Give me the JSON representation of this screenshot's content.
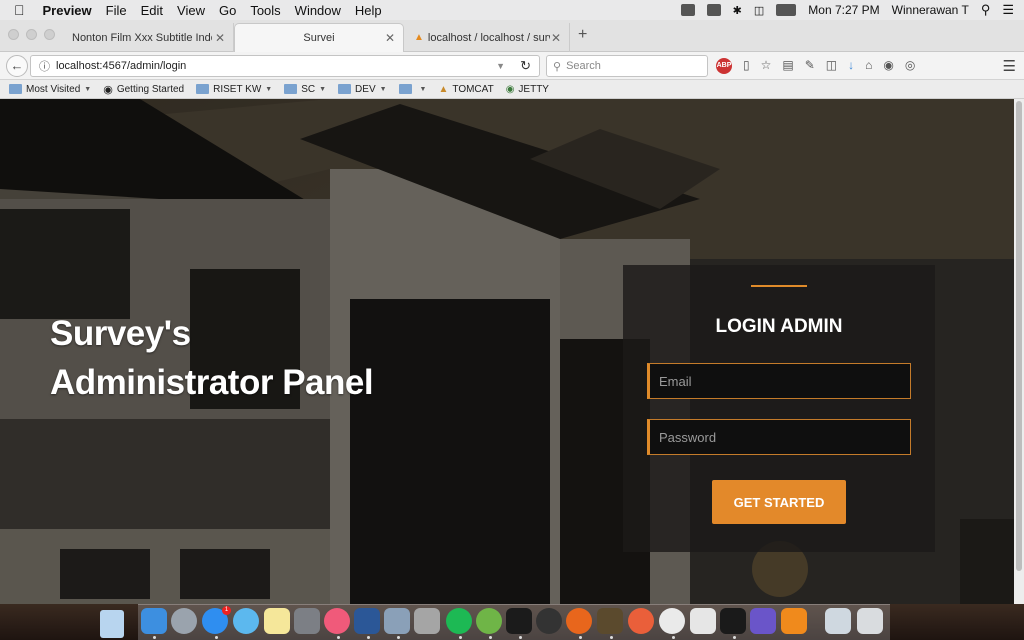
{
  "menubar": {
    "app_name": "Preview",
    "items": [
      "File",
      "Edit",
      "View",
      "Go",
      "Tools",
      "Window",
      "Help"
    ],
    "clock": "Mon 7:27 PM",
    "user": "Winnerawan T"
  },
  "tabs": [
    {
      "title": "Nonton Film Xxx Subtitle Indonesi"
    },
    {
      "title": "Survei"
    },
    {
      "title": "localhost / localhost / survey"
    }
  ],
  "nav": {
    "url": "localhost:4567/admin/login",
    "search_placeholder": "Search"
  },
  "bookmarks": [
    {
      "label": "Most Visited",
      "caret": true
    },
    {
      "label": "Getting Started",
      "caret": false
    },
    {
      "label": "RISET KW",
      "caret": true
    },
    {
      "label": "SC",
      "caret": true
    },
    {
      "label": "DEV",
      "caret": true
    },
    {
      "label": "",
      "caret": true
    },
    {
      "label": "TOMCAT",
      "caret": false
    },
    {
      "label": "JETTY",
      "caret": false
    }
  ],
  "hero": {
    "line1": "Survey's",
    "line2": "Administrator Panel"
  },
  "login": {
    "heading": "LOGIN ADMIN",
    "email_placeholder": "Email",
    "password_placeholder": "Password",
    "submit_label": "GET STARTED"
  },
  "dock": {
    "badge_count": "1"
  },
  "colors": {
    "accent": "#e3892a",
    "panel_bg": "#1c1a18",
    "field_bg": "#0f0f0f"
  }
}
